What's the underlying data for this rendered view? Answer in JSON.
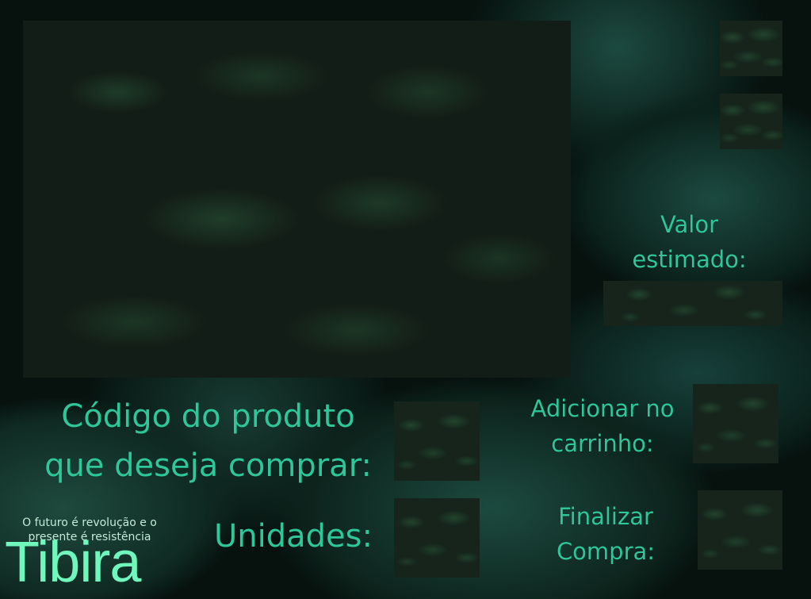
{
  "valor": {
    "label": "Valor\nestimado:"
  },
  "produto": {
    "codigo_label": "Código do produto\nque deseja comprar:",
    "codigo_value": "",
    "unidades_label": "Unidades:",
    "unidades_value": ""
  },
  "acoes": {
    "adicionar_label": "Adicionar no\ncarrinho:",
    "finalizar_label": "Finalizar\nCompra:"
  },
  "marca": {
    "tagline": "O futuro é revolução e o presente é resistência",
    "logo": "Tibira"
  },
  "colors": {
    "accent_text": "#2ec79a",
    "logo": "#6ff7bc",
    "tagline": "#c2ead7",
    "background": "#07120f",
    "panel": "#16241b"
  }
}
